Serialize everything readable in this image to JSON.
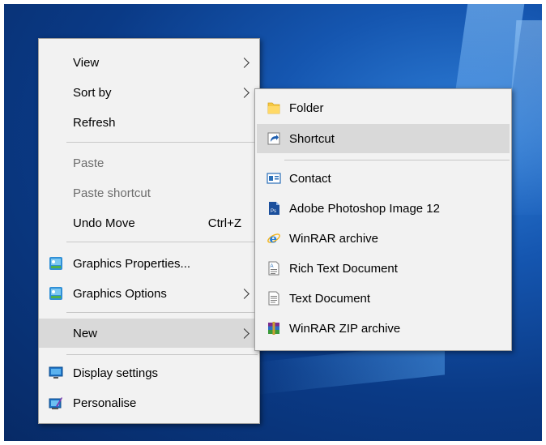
{
  "main_menu": {
    "items": [
      {
        "label": "View",
        "has_submenu": true
      },
      {
        "label": "Sort by",
        "has_submenu": true
      },
      {
        "label": "Refresh"
      },
      {
        "label": "Paste",
        "disabled": true
      },
      {
        "label": "Paste shortcut",
        "disabled": true
      },
      {
        "label": "Undo Move",
        "shortcut": "Ctrl+Z"
      },
      {
        "label": "Graphics Properties...",
        "icon": "graphics-icon"
      },
      {
        "label": "Graphics Options",
        "icon": "graphics-icon",
        "has_submenu": true
      },
      {
        "label": "New",
        "has_submenu": true,
        "highlighted": true
      },
      {
        "label": "Display settings",
        "icon": "display-icon"
      },
      {
        "label": "Personalise",
        "icon": "personalise-icon"
      }
    ]
  },
  "new_submenu": {
    "items": [
      {
        "label": "Folder",
        "icon": "folder-icon"
      },
      {
        "label": "Shortcut",
        "icon": "shortcut-icon",
        "highlighted": true
      },
      {
        "label": "Contact",
        "icon": "contact-icon"
      },
      {
        "label": "Adobe Photoshop Image 12",
        "icon": "photoshop-icon"
      },
      {
        "label": "WinRAR archive",
        "icon": "internet-explorer-icon"
      },
      {
        "label": "Rich Text Document",
        "icon": "rich-text-document-icon"
      },
      {
        "label": "Text Document",
        "icon": "text-document-icon"
      },
      {
        "label": "WinRAR ZIP archive",
        "icon": "winrar-icon"
      }
    ]
  },
  "colors": {
    "menu_bg": "#f2f2f2",
    "highlight": "#d9d9d9",
    "desktop": "#0a3a86"
  }
}
